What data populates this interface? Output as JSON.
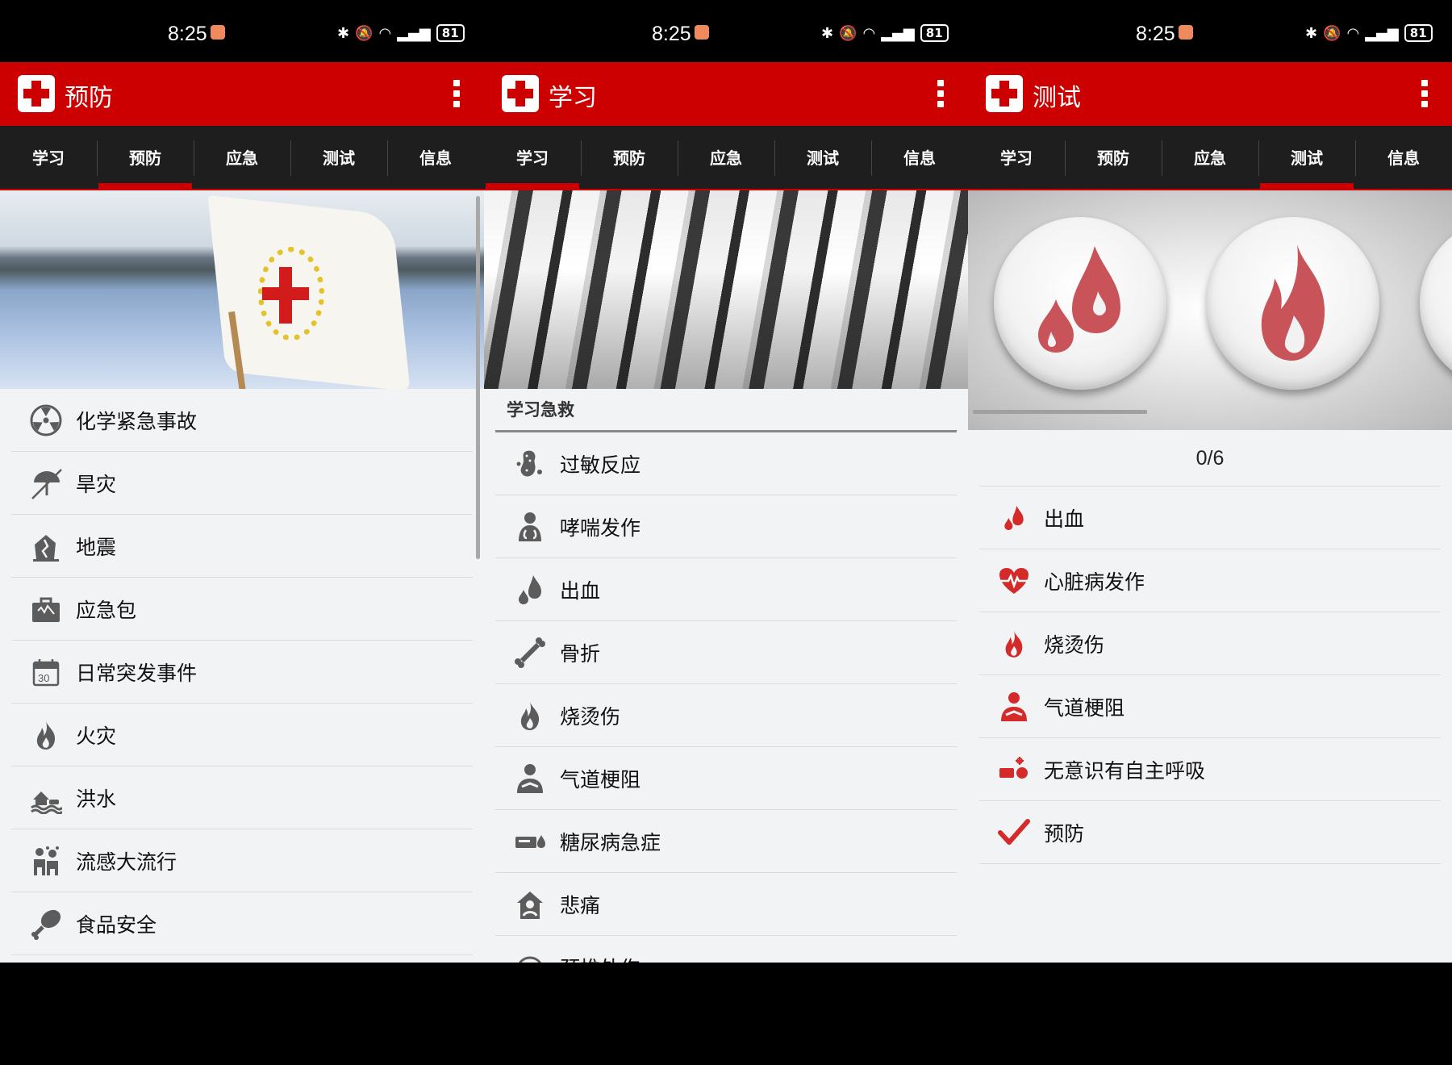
{
  "status": {
    "time": "8:25",
    "battery": "81"
  },
  "tabs": [
    "学习",
    "预防",
    "应急",
    "测试",
    "信息"
  ],
  "screen1": {
    "title": "预防",
    "active_tab": 1,
    "items": [
      {
        "label": "化学紧急事故",
        "icon": "radiation-icon"
      },
      {
        "label": "旱灾",
        "icon": "drought-umbrella-icon"
      },
      {
        "label": "地震",
        "icon": "earthquake-house-icon"
      },
      {
        "label": "应急包",
        "icon": "emergency-kit-icon"
      },
      {
        "label": "日常突发事件",
        "icon": "calendar-icon"
      },
      {
        "label": "火灾",
        "icon": "fire-icon"
      },
      {
        "label": "洪水",
        "icon": "flood-icon"
      },
      {
        "label": "流感大流行",
        "icon": "pandemic-people-icon"
      },
      {
        "label": "食品安全",
        "icon": "drumstick-icon"
      }
    ],
    "calendar_day": "30"
  },
  "screen2": {
    "title": "学习",
    "active_tab": 0,
    "section": "学习急救",
    "items": [
      {
        "label": "过敏反应",
        "icon": "allergy-peanut-icon"
      },
      {
        "label": "哮喘发作",
        "icon": "asthma-icon"
      },
      {
        "label": "出血",
        "icon": "blood-drop-icon"
      },
      {
        "label": "骨折",
        "icon": "bone-icon"
      },
      {
        "label": "烧烫伤",
        "icon": "fire-icon"
      },
      {
        "label": "气道梗阻",
        "icon": "choking-icon"
      },
      {
        "label": "糖尿病急症",
        "icon": "diabetes-icon"
      },
      {
        "label": "悲痛",
        "icon": "grief-icon"
      },
      {
        "label": "颈椎外伤",
        "icon": "neck-injury-icon"
      }
    ]
  },
  "screen3": {
    "title": "测试",
    "active_tab": 3,
    "progress": "0/6",
    "items": [
      {
        "label": "出血",
        "icon": "blood-drop-icon"
      },
      {
        "label": "心脏病发作",
        "icon": "heart-icon"
      },
      {
        "label": "烧烫伤",
        "icon": "fire-icon"
      },
      {
        "label": "气道梗阻",
        "icon": "choking-icon"
      },
      {
        "label": "无意识有自主呼吸",
        "icon": "unconscious-breathing-icon"
      },
      {
        "label": "预防",
        "icon": "checkmark-icon"
      }
    ]
  },
  "colors": {
    "brand_red": "#cc0000",
    "icon_gray": "#5c5c5c",
    "icon_red": "#d42a2a",
    "tab_bar": "#1e1e1e"
  }
}
